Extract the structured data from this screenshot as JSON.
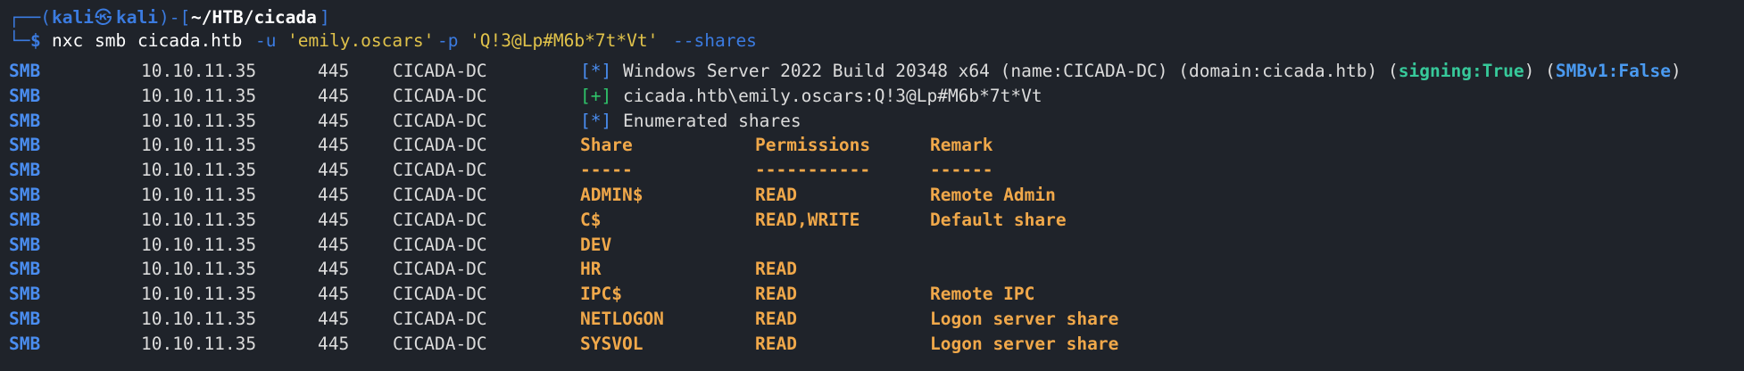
{
  "prompt": {
    "user": "kali",
    "symbol": "㉿",
    "host": "kali",
    "path": "~/HTB/cicada",
    "dollar": "$",
    "command": {
      "tool": "nxc",
      "proto": "smb",
      "target": "cicada.htb",
      "user_flag": "-u",
      "user_value": "'emily.oscars'",
      "pass_flag": "-p",
      "pass_value": "'Q!3@Lp#M6b*7t*Vt'",
      "shares_flag": "--shares"
    }
  },
  "rows_common": {
    "proto": "SMB",
    "ip": "10.10.11.35",
    "port": "445",
    "host": "CICADA-DC"
  },
  "info": {
    "line1_marker": "[*]",
    "line1_text": "Windows Server 2022 Build 20348 x64 (name:CICADA-DC) (domain:cicada.htb) (",
    "signing": "signing:True",
    "mid": ") (",
    "smbv1": "SMBv1:False",
    "end": ")",
    "line2_marker": "[+]",
    "line2_text": "cicada.htb\\emily.oscars:Q!3@Lp#M6b*7t*Vt",
    "line3_marker": "[*]",
    "line3_text": "Enumerated shares"
  },
  "table": {
    "headers": [
      "Share",
      "Permissions",
      "Remark"
    ],
    "separators": [
      "-----",
      "-----------",
      "------"
    ],
    "rows": [
      {
        "share": "ADMIN$",
        "perm": "READ",
        "remark": "Remote Admin"
      },
      {
        "share": "C$",
        "perm": "READ,WRITE",
        "remark": "Default share"
      },
      {
        "share": "DEV",
        "perm": "",
        "remark": ""
      },
      {
        "share": "HR",
        "perm": "READ",
        "remark": ""
      },
      {
        "share": "IPC$",
        "perm": "READ",
        "remark": "Remote IPC"
      },
      {
        "share": "NETLOGON",
        "perm": "READ",
        "remark": "Logon server share"
      },
      {
        "share": "SYSVOL",
        "perm": "READ",
        "remark": "Logon server share"
      }
    ]
  },
  "colors": {
    "background": "#1f232a",
    "prompt_blue": "#3b7be0",
    "smb_blue": "#4a8df0",
    "orange": "#f0a84a",
    "green": "#37c99a",
    "plus_green": "#2fc46a",
    "string_yellow": "#e0c24a"
  }
}
